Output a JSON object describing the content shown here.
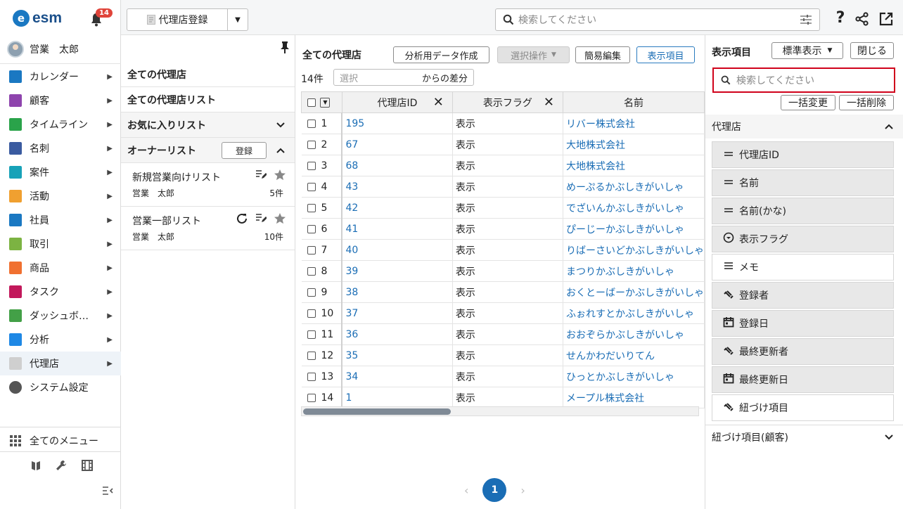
{
  "app": {
    "logo_letter": "e",
    "logo_text": "esm",
    "notification_count": "14",
    "user_name": "営業　太郎"
  },
  "sidebar": {
    "items": [
      {
        "label": "カレンダー",
        "icon": "calendar-icon",
        "color": "#1a78c2"
      },
      {
        "label": "顧客",
        "icon": "building-icon",
        "color": "#8e44ad"
      },
      {
        "label": "タイムライン",
        "icon": "chat-icon",
        "color": "#2aa34a"
      },
      {
        "label": "名刺",
        "icon": "card-icon",
        "color": "#3a5ba0"
      },
      {
        "label": "案件",
        "icon": "folder-icon",
        "color": "#17a2b8"
      },
      {
        "label": "活動",
        "icon": "clipboard-icon",
        "color": "#f0a030"
      },
      {
        "label": "社員",
        "icon": "person-icon",
        "color": "#1a78c2"
      },
      {
        "label": "取引",
        "icon": "deal-icon",
        "color": "#7cb342"
      },
      {
        "label": "商品",
        "icon": "box-icon",
        "color": "#f07030"
      },
      {
        "label": "タスク",
        "icon": "task-icon",
        "color": "#c2185b"
      },
      {
        "label": "ダッシュボ…",
        "icon": "dashboard-icon",
        "color": "#43a047"
      },
      {
        "label": "分析",
        "icon": "chart-icon",
        "color": "#1e88e5"
      },
      {
        "label": "代理店",
        "icon": "document-icon",
        "color": "#cfcfcf"
      },
      {
        "label": "システム設定",
        "icon": "gear-icon",
        "color": "#555555"
      }
    ],
    "all_menu": "全てのメニュー"
  },
  "topbar": {
    "register_label": "代理店登録",
    "search_placeholder": "検索してください"
  },
  "lists": {
    "all": "全ての代理店",
    "all_list": "全ての代理店リスト",
    "favorites": "お気に入りリスト",
    "owner": "オーナーリスト",
    "register": "登録",
    "sub": [
      {
        "name": "新規営業向けリスト",
        "owner": "営業　太郎",
        "count": "5件"
      },
      {
        "name": "営業一部リスト",
        "owner": "営業　太郎",
        "count": "10件"
      }
    ]
  },
  "main": {
    "title": "全ての代理店",
    "btn_export": "分析用データ作成",
    "btn_select_ops": "選択操作",
    "btn_quick_edit": "簡易編集",
    "btn_columns": "表示項目",
    "count": "14件",
    "select_placeholder": "選択",
    "diff_label": "からの差分",
    "columns": [
      "代理店ID",
      "表示フラグ",
      "名前"
    ],
    "rows": [
      [
        "1",
        "195",
        "表示",
        "リバー株式会社"
      ],
      [
        "2",
        "67",
        "表示",
        "大地株式会社"
      ],
      [
        "3",
        "68",
        "表示",
        "大地株式会社"
      ],
      [
        "4",
        "43",
        "表示",
        "めーぷるかぶしきがいしゃ"
      ],
      [
        "5",
        "42",
        "表示",
        "でざいんかぶしきがいしゃ"
      ],
      [
        "6",
        "41",
        "表示",
        "ぴーじーかぶしきがいしゃ"
      ],
      [
        "7",
        "40",
        "表示",
        "りばーさいどかぶしきがいしゃ"
      ],
      [
        "8",
        "39",
        "表示",
        "まつりかぶしきがいしゃ"
      ],
      [
        "9",
        "38",
        "表示",
        "おくとーばーかぶしきがいしゃ"
      ],
      [
        "10",
        "37",
        "表示",
        "ふぉれすとかぶしきがいしゃ"
      ],
      [
        "11",
        "36",
        "表示",
        "おおぞらかぶしきがいしゃ"
      ],
      [
        "12",
        "35",
        "表示",
        "せんかわだいりてん"
      ],
      [
        "13",
        "34",
        "表示",
        "ひっとかぶしきがいしゃ"
      ],
      [
        "14",
        "1",
        "表示",
        "メープル株式会社"
      ]
    ],
    "page": "1"
  },
  "rpanel": {
    "title": "表示項目",
    "standard": "標準表示",
    "close": "閉じる",
    "search_placeholder": "検索してください",
    "bulk_change": "一括変更",
    "bulk_delete": "一括削除",
    "section1": "代理店",
    "fields": [
      {
        "label": "代理店ID",
        "icon": "text-line-icon",
        "selected": false
      },
      {
        "label": "名前",
        "icon": "text-line-icon",
        "selected": false
      },
      {
        "label": "名前(かな)",
        "icon": "text-line-icon",
        "selected": false
      },
      {
        "label": "表示フラグ",
        "icon": "dropdown-circle-icon",
        "selected": false
      },
      {
        "label": "メモ",
        "icon": "multiline-icon",
        "selected": true
      },
      {
        "label": "登録者",
        "icon": "link-icon",
        "selected": false
      },
      {
        "label": "登録日",
        "icon": "calendar-icon",
        "selected": false
      },
      {
        "label": "最終更新者",
        "icon": "link-icon",
        "selected": false
      },
      {
        "label": "最終更新日",
        "icon": "calendar-icon",
        "selected": false
      },
      {
        "label": "紐づけ項目",
        "icon": "link-icon",
        "selected": true
      }
    ],
    "section2": "紐づけ項目(顧客)"
  }
}
